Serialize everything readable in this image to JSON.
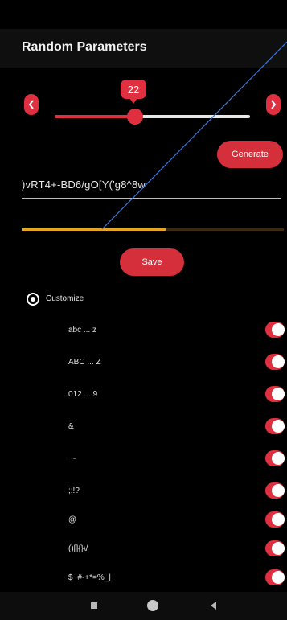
{
  "app": {
    "title": "Random Parameters"
  },
  "slider": {
    "value": "22",
    "fraction": 0.4
  },
  "buttons": {
    "generate_label": "Generate",
    "save_label": "Save"
  },
  "password": {
    "value": ")vRT4+-BD6/gO[Y('g8^8w"
  },
  "strength": {
    "fraction": 0.55,
    "color": "#e3a624"
  },
  "customize": {
    "label": "Customize",
    "selected": true
  },
  "options": [
    {
      "label": "abc ... z",
      "enabled": true
    },
    {
      "label": "ABC ... Z",
      "enabled": true
    },
    {
      "label": "012 ... 9",
      "enabled": true
    },
    {
      "label": "&",
      "enabled": true
    },
    {
      "label": "~-",
      "enabled": true
    },
    {
      "label": ";:!?",
      "enabled": true
    },
    {
      "label": "@",
      "enabled": true
    },
    {
      "label": "()[]{}\\/",
      "enabled": true
    },
    {
      "label": "$~#-+*=%_|",
      "enabled": true
    }
  ],
  "colors": {
    "accent": "#e03040",
    "strength": "#e3a624",
    "background": "#000000"
  }
}
